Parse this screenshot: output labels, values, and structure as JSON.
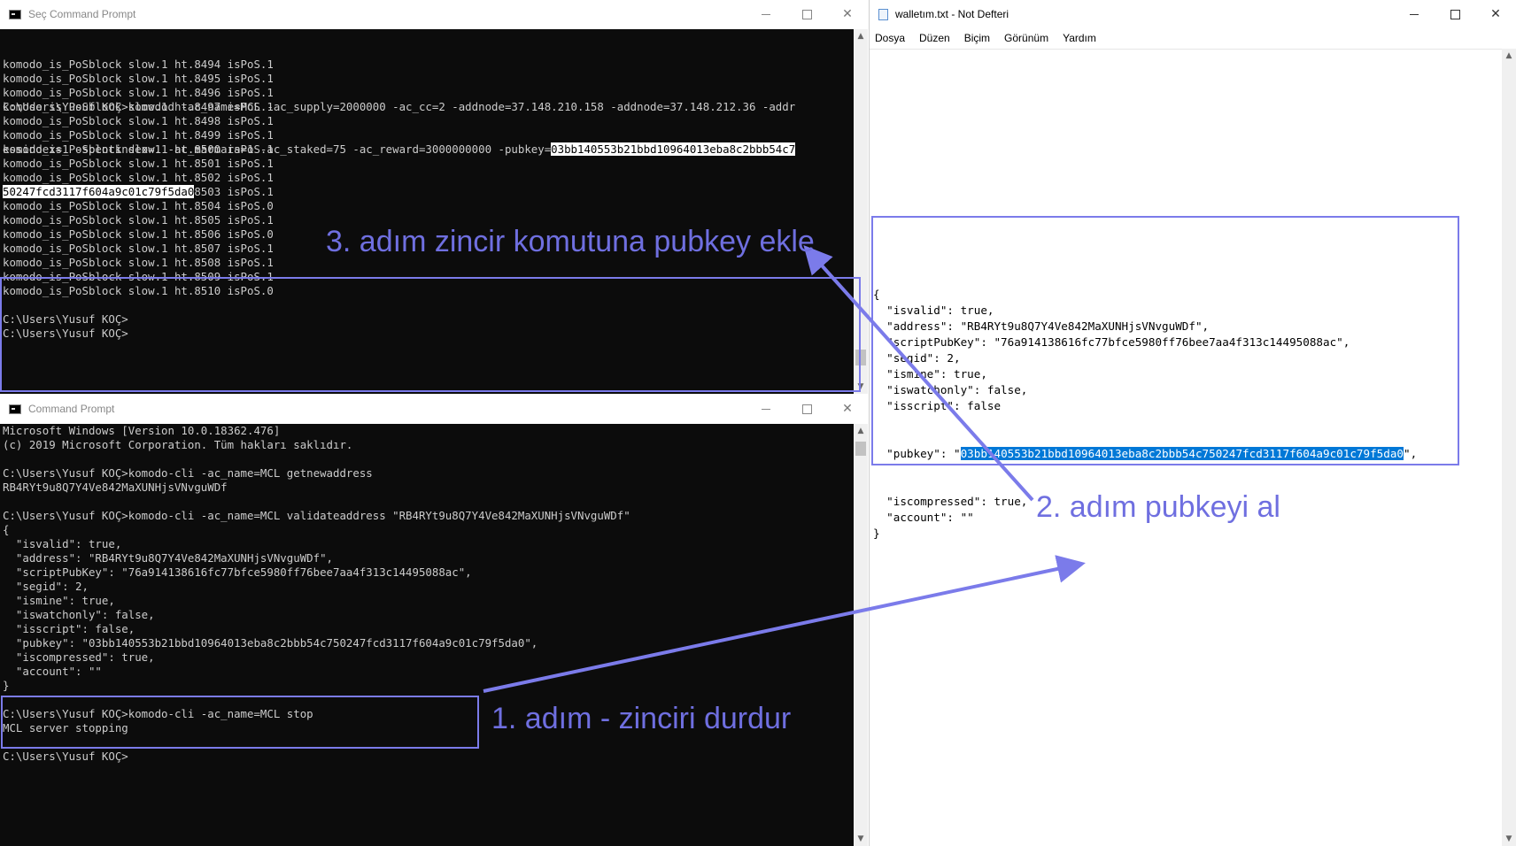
{
  "top_console": {
    "title": "Seç Command Prompt",
    "lines": [
      "komodo_is_PoSblock slow.1 ht.8494 isPoS.1",
      "komodo_is_PoSblock slow.1 ht.8495 isPoS.1",
      "komodo_is_PoSblock slow.1 ht.8496 isPoS.1",
      "komodo_is_PoSblock slow.1 ht.8497 isPoS.1",
      "komodo_is_PoSblock slow.1 ht.8498 isPoS.1",
      "komodo_is_PoSblock slow.1 ht.8499 isPoS.1",
      "komodo_is_PoSblock slow.1 ht.8500 isPoS.1",
      "komodo_is_PoSblock slow.1 ht.8501 isPoS.1",
      "komodo_is_PoSblock slow.1 ht.8502 isPoS.1",
      "komodo_is_PoSblock slow.1 ht.8503 isPoS.1",
      "komodo_is_PoSblock slow.1 ht.8504 isPoS.0",
      "komodo_is_PoSblock slow.1 ht.8505 isPoS.1",
      "komodo_is_PoSblock slow.1 ht.8506 isPoS.0",
      "komodo_is_PoSblock slow.1 ht.8507 isPoS.1",
      "komodo_is_PoSblock slow.1 ht.8508 isPoS.1",
      "komodo_is_PoSblock slow.1 ht.8509 isPoS.1",
      "komodo_is_PoSblock slow.1 ht.8510 isPoS.0",
      "",
      "C:\\Users\\Yusuf KOÇ>",
      "C:\\Users\\Yusuf KOÇ>"
    ],
    "cmd_line1_prefix": "C:\\Users\\Yusuf KOÇ>komodod -ac_name=MCL -ac_supply=2000000 -ac_cc=2 -addnode=37.148.210.158 -addnode=37.148.212.36 -addr",
    "cmd_line2_prefix": "essindex=1 -spentindex=1 -ac_marmara=1 -ac_staked=75 -ac_reward=3000000000 -pubkey=",
    "cmd_line2_selected": "03bb140553b21bbd10964013eba8c2bbb54c7",
    "cmd_line3_selected": "50247fcd3117f604a9c01c79f5da0"
  },
  "bottom_console": {
    "title": "Command Prompt",
    "lines": [
      "Microsoft Windows [Version 10.0.18362.476]",
      "(c) 2019 Microsoft Corporation. Tüm hakları saklıdır.",
      "",
      "C:\\Users\\Yusuf KOÇ>komodo-cli -ac_name=MCL getnewaddress",
      "RB4RYt9u8Q7Y4Ve842MaXUNHjsVNvguWDf",
      "",
      "C:\\Users\\Yusuf KOÇ>komodo-cli -ac_name=MCL validateaddress \"RB4RYt9u8Q7Y4Ve842MaXUNHjsVNvguWDf\"",
      "{",
      "  \"isvalid\": true,",
      "  \"address\": \"RB4RYt9u8Q7Y4Ve842MaXUNHjsVNvguWDf\",",
      "  \"scriptPubKey\": \"76a914138616fc77bfce5980ff76bee7aa4f313c14495088ac\",",
      "  \"segid\": 2,",
      "  \"ismine\": true,",
      "  \"iswatchonly\": false,",
      "  \"isscript\": false,",
      "  \"pubkey\": \"03bb140553b21bbd10964013eba8c2bbb54c750247fcd3117f604a9c01c79f5da0\",",
      "  \"iscompressed\": true,",
      "  \"account\": \"\"",
      "}",
      "",
      "C:\\Users\\Yusuf KOÇ>komodo-cli -ac_name=MCL stop",
      "MCL server stopping",
      "",
      "C:\\Users\\Yusuf KOÇ>"
    ]
  },
  "notepad": {
    "title": "walletım.txt - Not Defteri",
    "menu": [
      "Dosya",
      "Düzen",
      "Biçim",
      "Görünüm",
      "Yardım"
    ],
    "lines": [
      "{",
      "  \"isvalid\": true,",
      "  \"address\": \"RB4RYt9u8Q7Y4Ve842MaXUNHjsVNvguWDf\",",
      "  \"scriptPubKey\": \"76a914138616fc77bfce5980ff76bee7aa4f313c14495088ac\",",
      "  \"segid\": 2,",
      "  \"ismine\": true,",
      "  \"iswatchonly\": false,",
      "  \"isscript\": false"
    ],
    "pubkey_prefix": "  \"pubkey\": \"",
    "pubkey_selected": "03bb140553b21bbd10964013eba8c2bbb54c750247fcd3117f604a9c01c79f5da0",
    "pubkey_suffix": "\",",
    "lines_after": [
      "  \"iscompressed\": true,",
      "  \"account\": \"\"",
      "}"
    ]
  },
  "annotations": {
    "step1": "1. adım - zinciri durdur",
    "step2": "2. adım pubkeyi al",
    "step3": "3. adım zincir komutuna pubkey ekle",
    "color": "#6f6fe0"
  }
}
